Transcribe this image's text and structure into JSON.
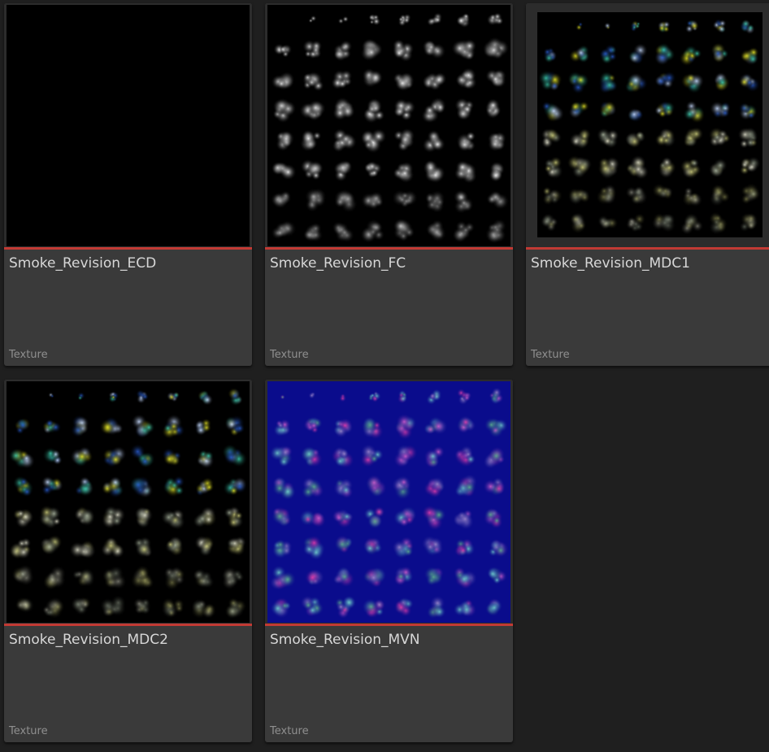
{
  "content_browser": {
    "type_bar_color": "#c23a34",
    "assets": [
      {
        "name": "Smoke_Revision_ECD",
        "type": "Texture",
        "thumbnail": "black-empty"
      },
      {
        "name": "Smoke_Revision_FC",
        "type": "Texture",
        "thumbnail": "smoke-flipbook-grayscale"
      },
      {
        "name": "Smoke_Revision_MDC1",
        "type": "Texture",
        "thumbnail": "smoke-flipbook-colored"
      },
      {
        "name": "Smoke_Revision_MDC2",
        "type": "Texture",
        "thumbnail": "smoke-flipbook-colored"
      },
      {
        "name": "Smoke_Revision_MVN",
        "type": "Texture",
        "thumbnail": "smoke-flipbook-normal"
      }
    ]
  }
}
